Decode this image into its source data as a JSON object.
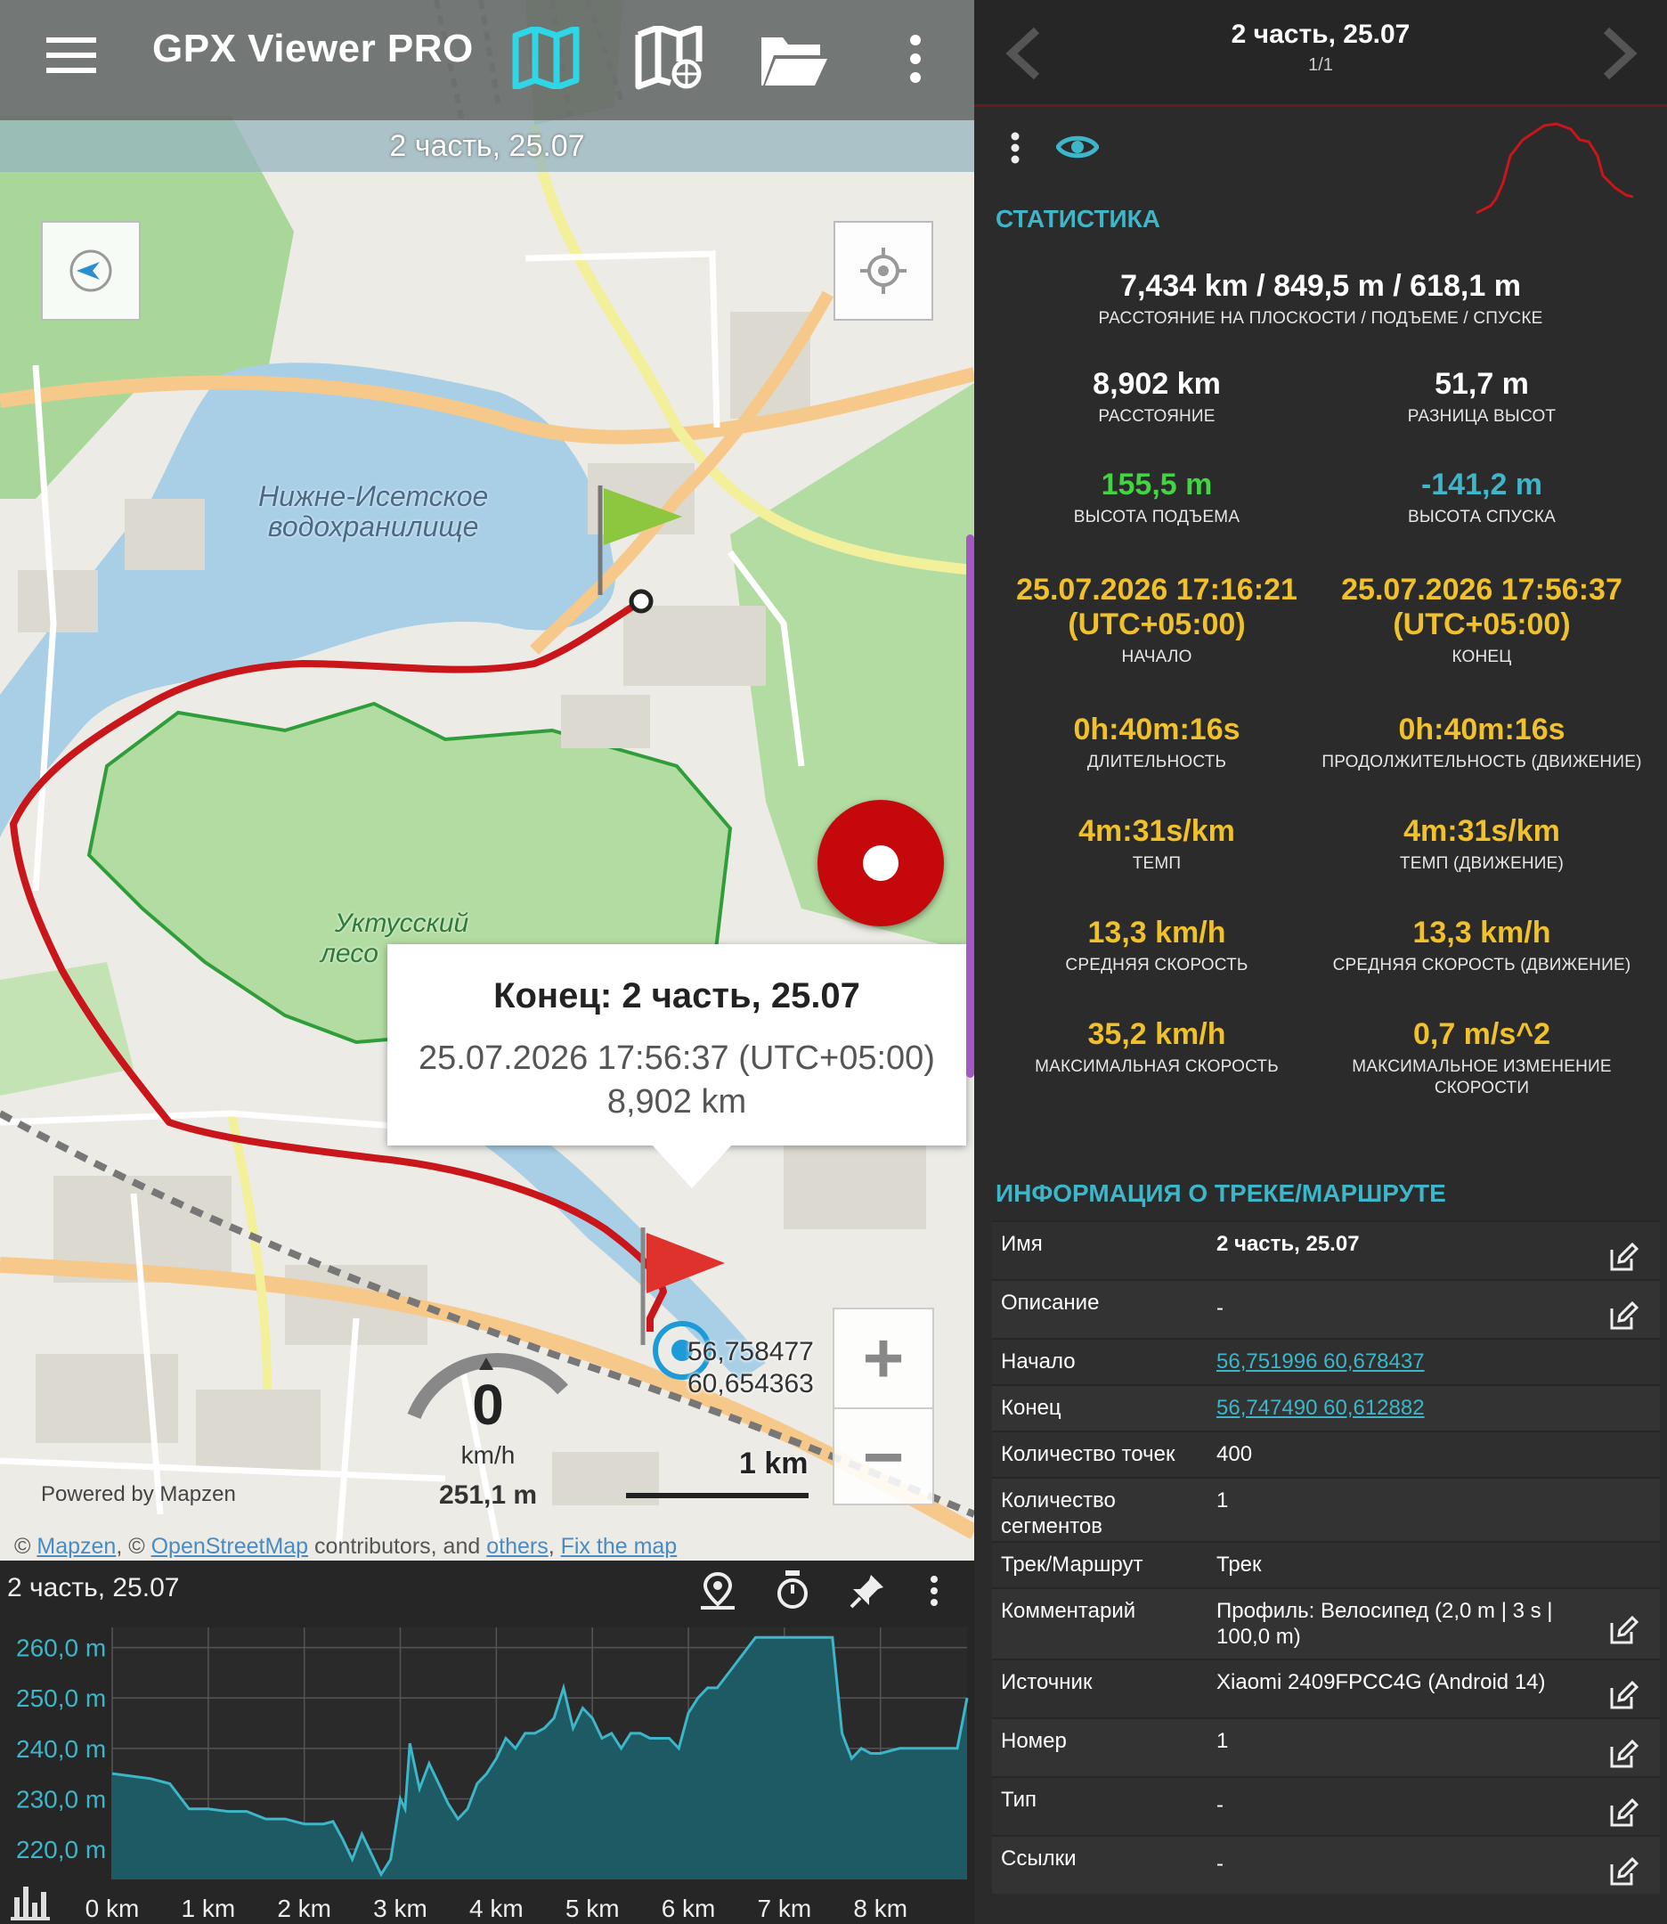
{
  "app": {
    "title": "GPX Viewer PRO"
  },
  "map": {
    "track_banner": "2 часть, 25.07",
    "popup": {
      "title": "Конец: 2 часть, 25.07",
      "time": "25.07.2026 17:56:37 (UTC+05:00)",
      "distance": "8,902 km"
    },
    "labels": {
      "reservoir_1": "Нижне-Исетское",
      "reservoir_2": "водохранилище",
      "forest_1": "Уктусский",
      "forest_2": "лесо"
    },
    "position": {
      "lat": "56,758477",
      "lon": "60,654363"
    },
    "speed": {
      "value": "0",
      "unit": "km/h",
      "altitude": "251,1 m"
    },
    "scale": "1 km",
    "powered_by": "Powered by Mapzen",
    "attribution": {
      "c1": "©",
      "mapzen": "Mapzen",
      "sep1": ", ©",
      "osm": "OpenStreetMap",
      "mid": "contributors, and",
      "others": "others",
      "sep2": ",",
      "fix": "Fix the map"
    },
    "zoom_in": "+",
    "zoom_out": "−",
    "track_color": "#c8161b"
  },
  "chart": {
    "title": "2 часть, 25.07",
    "chart_data": {
      "type": "area",
      "ylabel": "",
      "xlabel": "",
      "ylim": [
        214,
        264
      ],
      "xlim": [
        0,
        8.902
      ],
      "y_ticks": [
        "220,0 m",
        "230,0 m",
        "240,0 m",
        "250,0 m",
        "260,0 m"
      ],
      "y_tick_values": [
        220,
        230,
        240,
        250,
        260
      ],
      "x_ticks": [
        "0 km",
        "1 km",
        "2 km",
        "3 km",
        "4 km",
        "5 km",
        "6 km",
        "7 km",
        "8 km"
      ],
      "x_tick_values": [
        0,
        1,
        2,
        3,
        4,
        5,
        6,
        7,
        8
      ],
      "grid": true,
      "fill_color": "#1e5a64",
      "line_color": "#3cb6c8",
      "series": [
        {
          "x": [
            0,
            0.2,
            0.4,
            0.6,
            0.8,
            1.0,
            1.2,
            1.4,
            1.6,
            1.8,
            2.0,
            2.2,
            2.3,
            2.4,
            2.5,
            2.6,
            2.7,
            2.8,
            2.9,
            3.0,
            3.05,
            3.1,
            3.2,
            3.3,
            3.4,
            3.5,
            3.6,
            3.7,
            3.8,
            3.9,
            4.0,
            4.1,
            4.2,
            4.3,
            4.4,
            4.5,
            4.6,
            4.7,
            4.8,
            4.9,
            5.0,
            5.1,
            5.2,
            5.3,
            5.4,
            5.5,
            5.6,
            5.7,
            5.8,
            5.9,
            6.0,
            6.1,
            6.2,
            6.3,
            6.5,
            6.7,
            6.9,
            7.1,
            7.3,
            7.5,
            7.6,
            7.7,
            7.8,
            7.9,
            8.0,
            8.2,
            8.4,
            8.6,
            8.8,
            8.902
          ],
          "y": [
            235,
            234.5,
            234,
            233,
            228,
            228,
            227.5,
            227.5,
            226,
            226,
            225,
            225,
            225.5,
            222,
            218,
            223,
            219,
            215,
            218,
            230,
            228,
            241,
            232,
            237,
            233,
            229,
            226,
            228,
            233,
            235,
            238,
            242,
            240,
            243,
            243,
            244,
            246,
            252,
            244,
            248,
            246,
            242,
            243,
            240,
            243,
            243,
            242,
            242,
            242,
            240,
            247,
            250,
            252,
            252,
            257,
            262,
            262,
            262,
            262,
            262,
            243,
            238,
            240,
            239,
            239,
            240,
            240,
            240,
            240,
            250
          ]
        }
      ]
    }
  },
  "right": {
    "header": {
      "title": "2 часть, 25.07",
      "sub": "1/1"
    },
    "stats_heading": "СТАТИСТИКА",
    "summary": {
      "value": "7,434 km / 849,5 m / 618,1 m",
      "label": "РАССТОЯНИЕ НА ПЛОСКОСТИ / ПОДЪЕМЕ / СПУСКЕ"
    },
    "stats": [
      {
        "value": "8,902 km",
        "label": "РАССТОЯНИЕ"
      },
      {
        "value": "51,7 m",
        "label": "РАЗНИЦА ВЫСОТ"
      },
      {
        "value": "155,5 m",
        "label": "ВЫСОТА ПОДЪЕМА"
      },
      {
        "value": "-141,2 m",
        "label": "ВЫСОТА СПУСКА"
      },
      {
        "value": "25.07.2026 17:16:21",
        "value2": "(UTC+05:00)",
        "label": "НАЧАЛО"
      },
      {
        "value": "25.07.2026 17:56:37",
        "value2": "(UTC+05:00)",
        "label": "КОНЕЦ"
      },
      {
        "value": "0h:40m:16s",
        "label": "ДЛИТЕЛЬНОСТЬ"
      },
      {
        "value": "0h:40m:16s",
        "label": "ПРОДОЛЖИТЕЛЬНОСТЬ (ДВИЖЕНИЕ)"
      },
      {
        "value": "4m:31s/km",
        "label": "ТЕМП"
      },
      {
        "value": "4m:31s/km",
        "label": "ТЕМП (ДВИЖЕНИЕ)"
      },
      {
        "value": "13,3 km/h",
        "label": "СРЕДНЯЯ СКОРОСТЬ"
      },
      {
        "value": "13,3 km/h",
        "label": "СРЕДНЯЯ СКОРОСТЬ (ДВИЖЕНИЕ)"
      },
      {
        "value": "35,2 km/h",
        "label": "МАКСИМАЛЬНАЯ СКОРОСТЬ"
      },
      {
        "value": "0,7 m/s^2",
        "label": "МАКСИМАЛЬНОЕ ИЗМЕНЕНИЕ",
        "label2": "СКОРОСТИ"
      }
    ],
    "info_heading": "ИНФОРМАЦИЯ О ТРЕКЕ/МАРШРУТЕ",
    "info": [
      {
        "key": "Имя",
        "value": "2 часть, 25.07"
      },
      {
        "key": "Описание",
        "value": "-"
      },
      {
        "key": "Начало",
        "value": "56,751996 60,678437"
      },
      {
        "key": "Конец",
        "value": "56,747490 60,612882"
      },
      {
        "key": "Количество точек",
        "value": "400"
      },
      {
        "key": "Количество",
        "key2": "сегментов",
        "value": "1"
      },
      {
        "key": "Трек/Маршрут",
        "value": "Трек"
      },
      {
        "key": "Комментарий",
        "value": "Профиль: Велосипед (2,0 m | 3 s |",
        "value2": "100,0 m)"
      },
      {
        "key": "Источник",
        "value": "Xiaomi 2409FPCC4G (Android 14)"
      },
      {
        "key": "Номер",
        "value": "1"
      },
      {
        "key": "Тип",
        "value": "-"
      },
      {
        "key": "Ссылки",
        "value": "-"
      }
    ],
    "colors": {
      "accent": "#3cb6c8",
      "green": "#43d443",
      "yellow": "#f0c12a"
    }
  }
}
